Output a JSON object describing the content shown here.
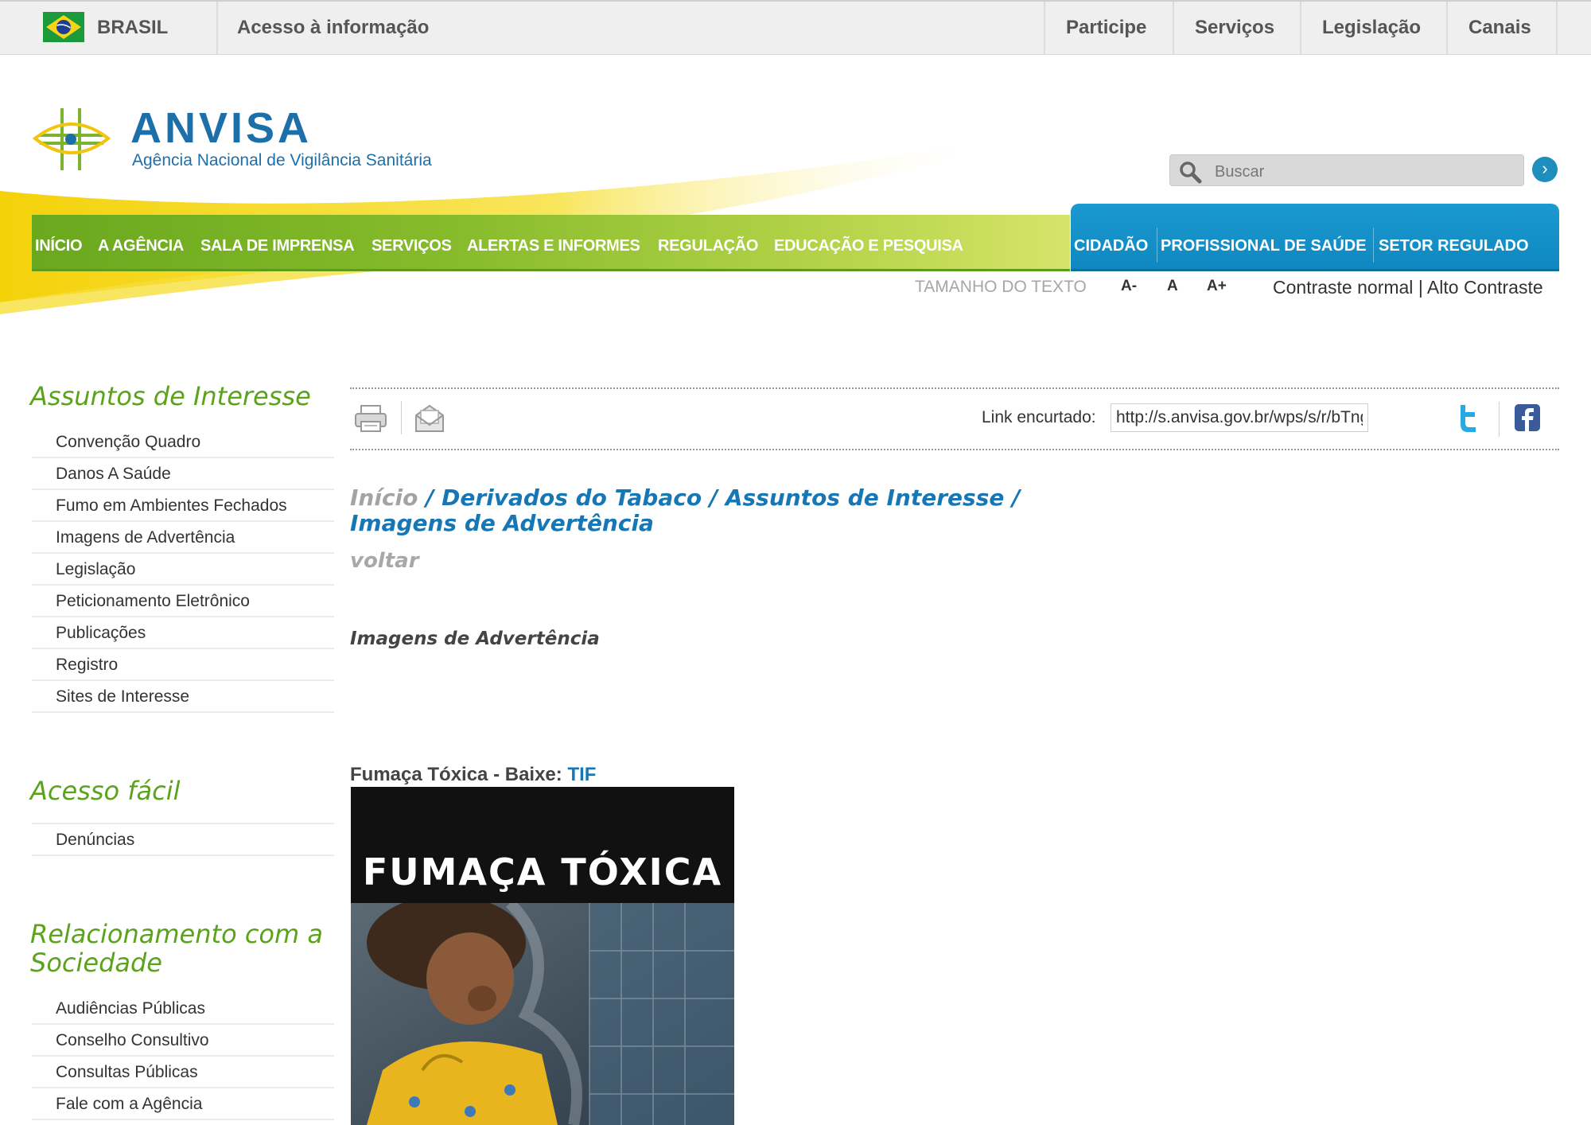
{
  "gov_bar": {
    "country": "BRASIL",
    "access_info": "Acesso à informação",
    "links": [
      "Participe",
      "Serviços",
      "Legislação",
      "Canais"
    ]
  },
  "header": {
    "brand_name": "ANVISA",
    "brand_subtitle": "Agência Nacional de Vigilância Sanitária",
    "search_placeholder": "Buscar"
  },
  "main_nav": [
    "INÍCIO",
    "A AGÊNCIA",
    "SALA DE IMPRENSA",
    "SERVIÇOS",
    "ALERTAS E INFORMES",
    "REGULAÇÃO",
    "EDUCAÇÃO E PESQUISA"
  ],
  "audience_nav": [
    "CIDADÃO",
    "PROFISSIONAL DE SAÚDE",
    "SETOR REGULADO"
  ],
  "text_size": {
    "label": "TAMANHO DO TEXTO",
    "decrease": "A-",
    "normal": "A",
    "increase": "A+"
  },
  "contrast": {
    "normal": "Contraste normal",
    "separator": "|",
    "high": "Alto Contraste"
  },
  "sidebar": {
    "sections": [
      {
        "title": "Assuntos de Interesse",
        "items": [
          "Convenção Quadro",
          "Danos A Saúde",
          "Fumo em Ambientes Fechados",
          "Imagens de Advertência",
          "Legislação",
          "Peticionamento Eletrônico",
          "Publicações",
          "Registro",
          "Sites de Interesse"
        ]
      },
      {
        "title": "Acesso fácil",
        "items": [
          "Denúncias"
        ]
      },
      {
        "title": "Relacionamento com a Sociedade",
        "items": [
          "Audiências Públicas",
          "Conselho Consultivo",
          "Consultas Públicas",
          "Fale com a Agência"
        ]
      }
    ]
  },
  "toolbar": {
    "short_link_label": "Link encurtado:",
    "short_link_value": "http://s.anvisa.gov.br/wps/s/r/bTng"
  },
  "breadcrumb": {
    "home": "Início",
    "separator": " / ",
    "items": [
      "Derivados do Tabaco",
      "Assuntos de Interesse",
      "Imagens de Advertência"
    ]
  },
  "content": {
    "back_link": "voltar",
    "title": "Imagens de Advertência",
    "figure_caption": "Fumaça Tóxica - Baixe:",
    "figure_download": "TIF",
    "figure_image_text": "FUMAÇA TÓXICA"
  },
  "colors": {
    "brand_blue": "#1d6fa9",
    "nav_green": "#6aa81e",
    "audience_blue": "#0f87c0",
    "sidebar_green": "#5aa31b",
    "link_blue": "#1677b4"
  }
}
